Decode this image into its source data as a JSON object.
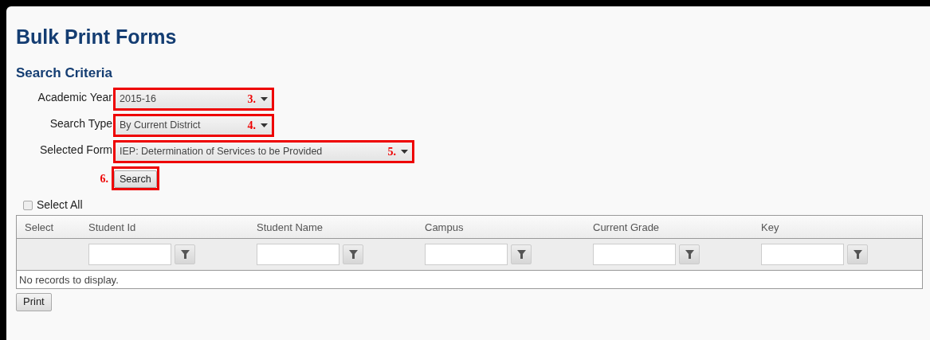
{
  "page_title": "Bulk Print Forms",
  "section_title": "Search Criteria",
  "criteria": [
    {
      "label": "Academic Year",
      "value": "2015-16",
      "marker": "3."
    },
    {
      "label": "Search Type",
      "value": "By Current District",
      "marker": "4."
    },
    {
      "label": "Selected Form",
      "value": "IEP: Determination of Services to be Provided",
      "marker": "5."
    }
  ],
  "search_button": {
    "label": "Search",
    "marker": "6."
  },
  "select_all": {
    "label": "Select All",
    "checked": false
  },
  "table": {
    "columns": [
      {
        "label": "Select",
        "filter": false
      },
      {
        "label": "Student Id",
        "filter": true
      },
      {
        "label": "Student Name",
        "filter": true
      },
      {
        "label": "Campus",
        "filter": true
      },
      {
        "label": "Current Grade",
        "filter": true
      },
      {
        "label": "Key",
        "filter": true
      }
    ],
    "empty_message": "No records to display."
  },
  "print_button": "Print"
}
